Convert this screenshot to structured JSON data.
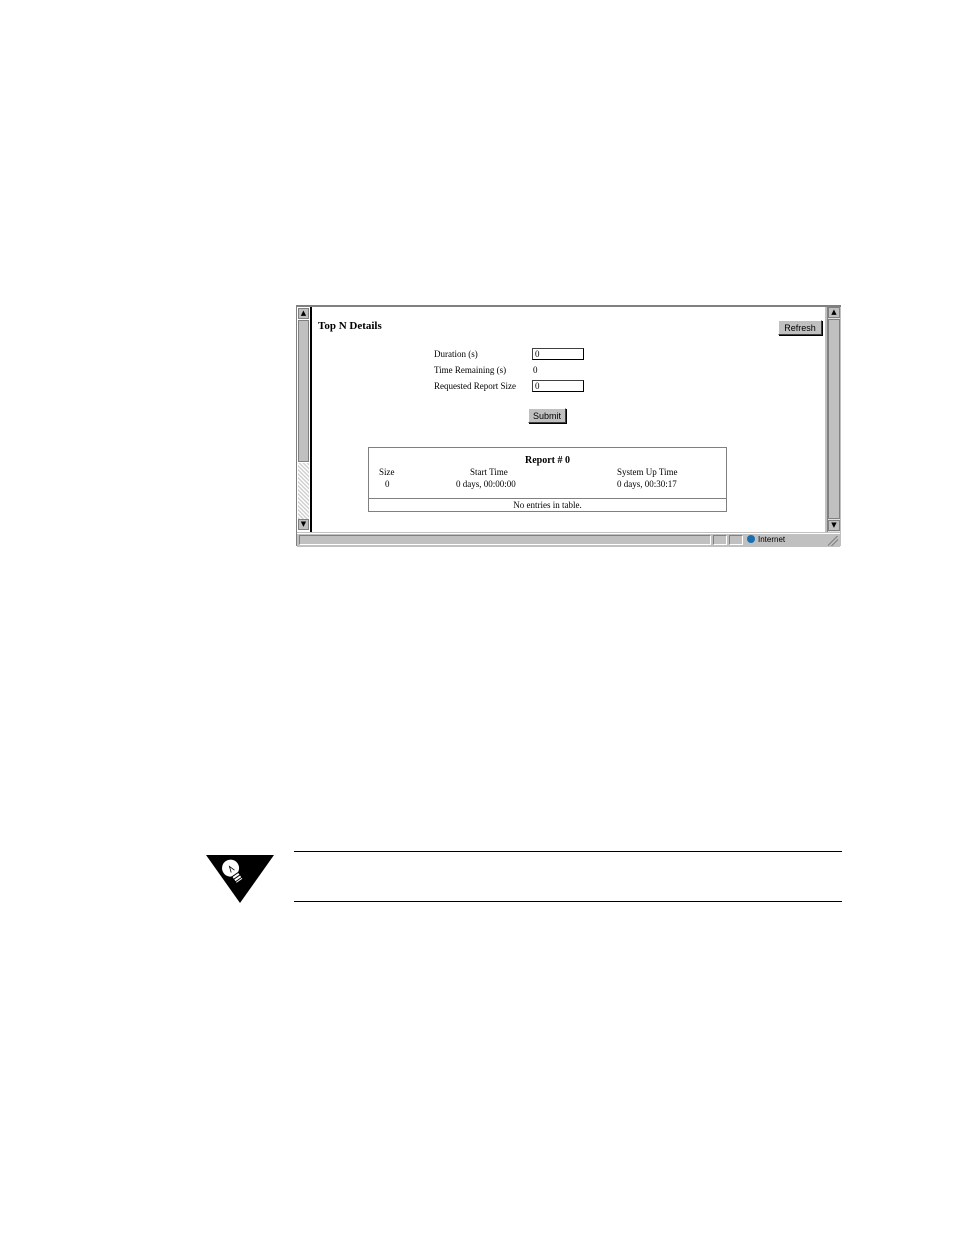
{
  "browser": {
    "page_title": "Top N Details",
    "refresh_label": "Refresh",
    "fields": [
      {
        "label": "Duration (s)",
        "type": "input",
        "value": "0"
      },
      {
        "label": "Time Remaining (s)",
        "type": "text",
        "value": "0"
      },
      {
        "label": "Requested Report Size",
        "type": "input",
        "value": "0"
      }
    ],
    "submit_label": "Submit",
    "report": {
      "title": "Report # 0",
      "headers": [
        "Size",
        "Start Time",
        "System Up Time"
      ],
      "values": [
        "0",
        "0 days, 00:00:00",
        "0 days, 00:30:17"
      ],
      "empty_message": "No entries in table."
    },
    "status": {
      "zone_label": "Internet"
    }
  },
  "note": {
    "icon": "lightbulb-note-icon"
  }
}
